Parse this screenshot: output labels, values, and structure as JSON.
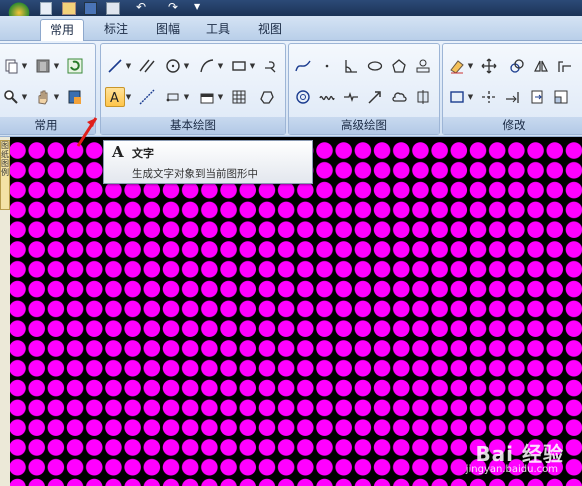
{
  "tabs": [
    {
      "label": "常用",
      "active": true
    },
    {
      "label": "标注",
      "active": false
    },
    {
      "label": "图幅",
      "active": false
    },
    {
      "label": "工具",
      "active": false
    },
    {
      "label": "视图",
      "active": false
    }
  ],
  "groups": {
    "common": "常用",
    "basic_draw": "基本绘图",
    "advanced_draw": "高级绘图",
    "modify": "修改"
  },
  "tooltip": {
    "icon": "A",
    "title": "文字",
    "description": "生成文字对象到当前图形中"
  },
  "side_panel": {
    "label": "图 纸 图 例"
  },
  "watermark": {
    "brand": "Bai 经验",
    "url": "jingyan.baidu.com"
  },
  "colors": {
    "dots": "#ff00ff",
    "canvas_background": "#000000",
    "highlight": "#ffc54a",
    "arrow": "#e0201c"
  },
  "icons": {
    "text_tool": "text-a-icon",
    "line_tool": "line-icon",
    "circle_tool": "circle-icon",
    "arc_tool": "arc-icon",
    "rectangle_tool": "rectangle-icon"
  }
}
